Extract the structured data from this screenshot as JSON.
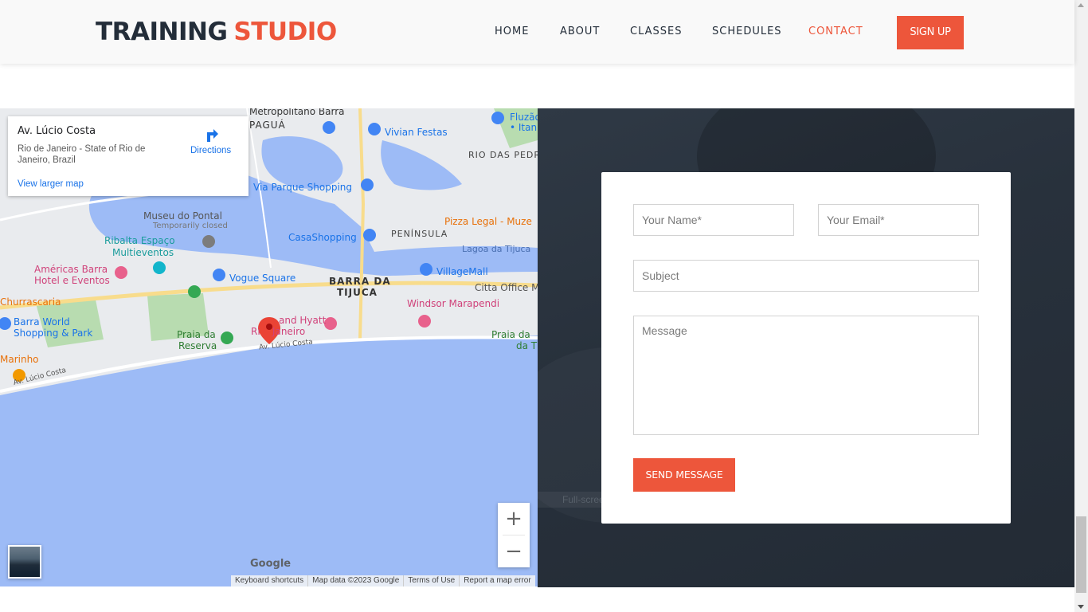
{
  "header": {
    "logo_part1": "TRAINING",
    "logo_part2": "STUDIO",
    "nav": [
      "HOME",
      "ABOUT",
      "CLASSES",
      "SCHEDULES",
      "CONTACT"
    ],
    "active_nav": "CONTACT",
    "signup_label": "SIGN UP"
  },
  "map": {
    "info_title": "Av. Lúcio Costa",
    "info_address": "Rio de Janeiro - State of Rio de Janeiro, Brazil",
    "view_larger": "View larger map",
    "directions": "Directions",
    "labels": {
      "metropolitano": "Metropolitano Barra",
      "pagua": "PAGUÁ",
      "fluzao": "Fluzão",
      "itanh": "• Itanh",
      "vivian": "Vivian Festas",
      "rio_das_pedr": "RIO DAS PEDR",
      "via_parque": "Via Parque Shopping",
      "museu": "Museu do Pontal",
      "temp_closed": "Temporarily closed",
      "pizza": "Pizza Legal - Muze",
      "ribalta1": "Ribalta Espaço",
      "ribalta2": "Multieventos",
      "casashopping": "CasaShopping",
      "peninsula": "PENÍNSULA",
      "lagoa": "Lagoa da Tijuca",
      "americas1": "Américas Barra",
      "americas2": "Hotel e Eventos",
      "villagemall": "VillageMall",
      "vogue": "Vogue Square",
      "barra1": "BARRA DA",
      "barra2": "TIJUCA",
      "citta": "Citta Office M",
      "churrascaria": "Churrascaria",
      "windsor": "Windsor Marapendi",
      "barraworld1": "Barra World",
      "barraworld2": "Shopping & Park",
      "grandhyatt1": "and Hyatt",
      "grandhyatt2": "Ri    Janeiro",
      "praia_reserva1": "Praia da",
      "praia_reserva2": "Reserva",
      "praia_da1": "Praia da",
      "praia_da2": "da T",
      "avlucio1": "Av. Lúcio Costa",
      "avlucio2": "Av. Lúcio Costa",
      "marinho": "Marinho"
    },
    "zoom_in": "+",
    "zoom_out": "−",
    "google": "Google",
    "attribution": [
      "Keyboard shortcuts",
      "Map data ©2023 Google",
      "Terms of Use",
      "Report a map error"
    ]
  },
  "form": {
    "name_placeholder": "Your Name*",
    "email_placeholder": "Your Email*",
    "subject_placeholder": "Subject",
    "message_placeholder": "Message",
    "send_label": "SEND MESSAGE",
    "ghost_text": "Full-screen Snip"
  },
  "colors": {
    "accent": "#ed563b",
    "dark": "#232d39",
    "map_water": "#9dbbf6"
  }
}
